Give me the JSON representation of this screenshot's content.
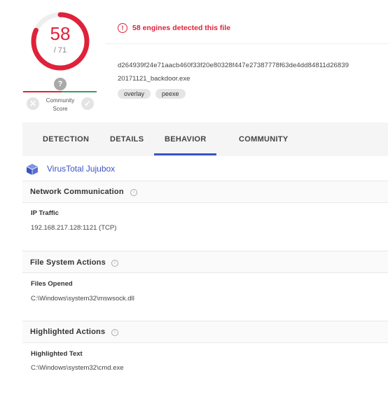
{
  "score": {
    "detected": "58",
    "total": "/ 71",
    "gauge_fraction": 0.8169,
    "gauge_color": "#e0213a"
  },
  "community": {
    "badge": "?",
    "label_line1": "Community",
    "label_line2": "Score",
    "vote_down": "✕",
    "vote_up": "✓"
  },
  "alert": {
    "icon": "!",
    "text": "58 engines detected this file",
    "color": "#e0213a"
  },
  "file": {
    "hash": "d264939f24e71aacb460f33f20e80328f447e27387778f63de4dd84811d26839",
    "name": "20171121_backdoor.exe",
    "tags": [
      "overlay",
      "peexe"
    ]
  },
  "tabs": [
    {
      "label": "DETECTION"
    },
    {
      "label": "DETAILS"
    },
    {
      "label": "BEHAVIOR",
      "active": true
    },
    {
      "label": "COMMUNITY"
    }
  ],
  "accent_color": "#3a53c5",
  "sandbox": {
    "icon": "cube-icon",
    "name": "VirusTotal Jujubox"
  },
  "sections": [
    {
      "title": "Network Communication",
      "info_icon": "i",
      "subtitle": "IP Traffic",
      "value": "192.168.217.128:1121 (TCP)"
    },
    {
      "title": "File System Actions",
      "info_icon": "i",
      "subtitle": "Files Opened",
      "value": "C:\\Windows\\system32\\mswsock.dll"
    },
    {
      "title": "Highlighted Actions",
      "info_icon": "i",
      "subtitle": "Highlighted Text",
      "value": "C:\\Windows\\system32\\cmd.exe"
    }
  ]
}
